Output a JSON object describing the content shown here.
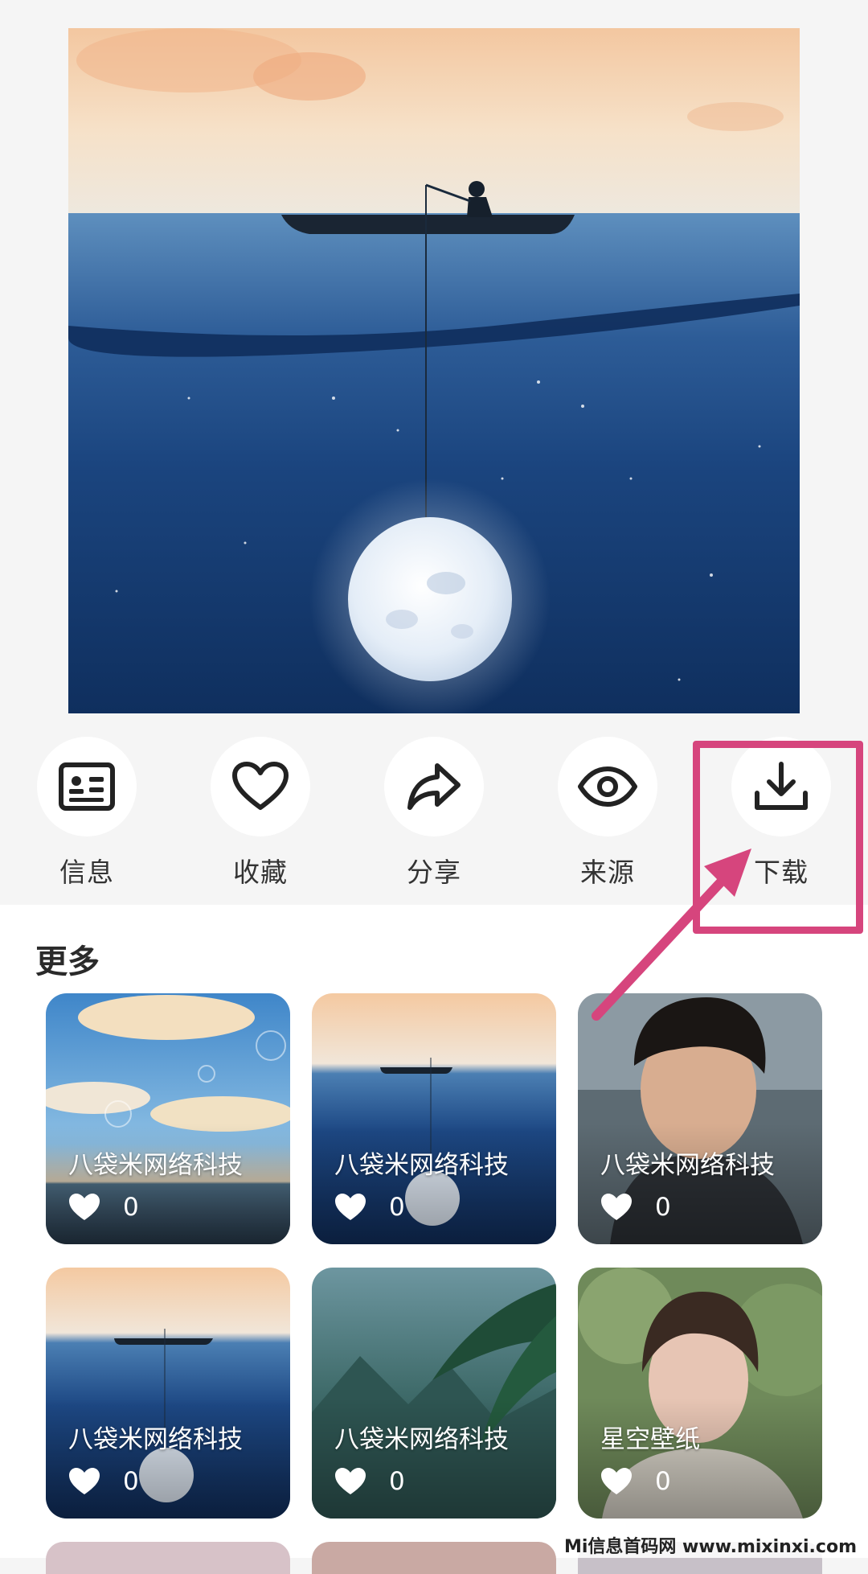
{
  "actions": [
    {
      "label": "信息",
      "icon": "info-card-icon"
    },
    {
      "label": "收藏",
      "icon": "heart-outline-icon"
    },
    {
      "label": "分享",
      "icon": "share-arrow-icon"
    },
    {
      "label": "来源",
      "icon": "eye-icon"
    },
    {
      "label": "下载",
      "icon": "download-icon"
    }
  ],
  "more": {
    "title": "更多",
    "cards": [
      {
        "title": "八袋米网络科技",
        "likes": "0",
        "scene": "sky-clouds"
      },
      {
        "title": "八袋米网络科技",
        "likes": "0",
        "scene": "moon-fishing"
      },
      {
        "title": "八袋米网络科技",
        "likes": "0",
        "scene": "portrait-boy"
      },
      {
        "title": "八袋米网络科技",
        "likes": "0",
        "scene": "moon-fishing"
      },
      {
        "title": "八袋米网络科技",
        "likes": "0",
        "scene": "palm-valley"
      },
      {
        "title": "星空壁纸",
        "likes": "0",
        "scene": "portrait-girl"
      }
    ]
  },
  "watermark": "Mi信息首码网 www.mixinxi.com",
  "colors": {
    "highlight": "#d6457d",
    "page_bg": "#f5f5f5",
    "text": "#333333"
  }
}
